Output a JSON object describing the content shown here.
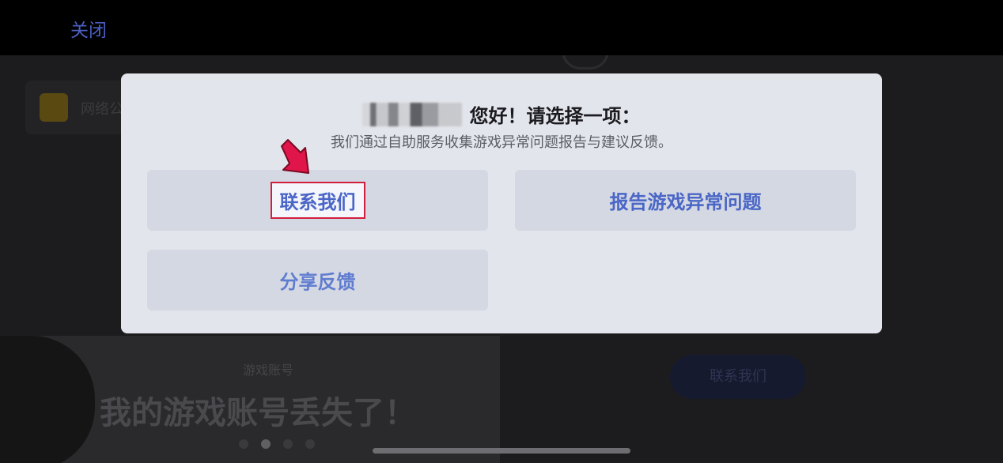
{
  "topbar": {
    "close_label": "关闭"
  },
  "background": {
    "news_text": "网络公告",
    "hint": "游戏账号",
    "headline": "我的游戏账号丢失了！",
    "contact_button": "联系我们",
    "carousel_dots": 4
  },
  "modal": {
    "title": "您好！请选择一项：",
    "subtitle": "我们通过自助服务收集游戏异常问题报告与建议反馈。",
    "options": [
      {
        "label": "联系我们",
        "highlighted": true
      },
      {
        "label": "报告游戏异常问题",
        "highlighted": false
      },
      {
        "label": "分享反馈",
        "highlighted": false
      }
    ]
  },
  "colors": {
    "accent": "#4a66c7",
    "highlight_border": "#d11e3c",
    "arrow": "#e0154a"
  },
  "icons": {
    "pointer": "arrow-pointer-icon"
  }
}
